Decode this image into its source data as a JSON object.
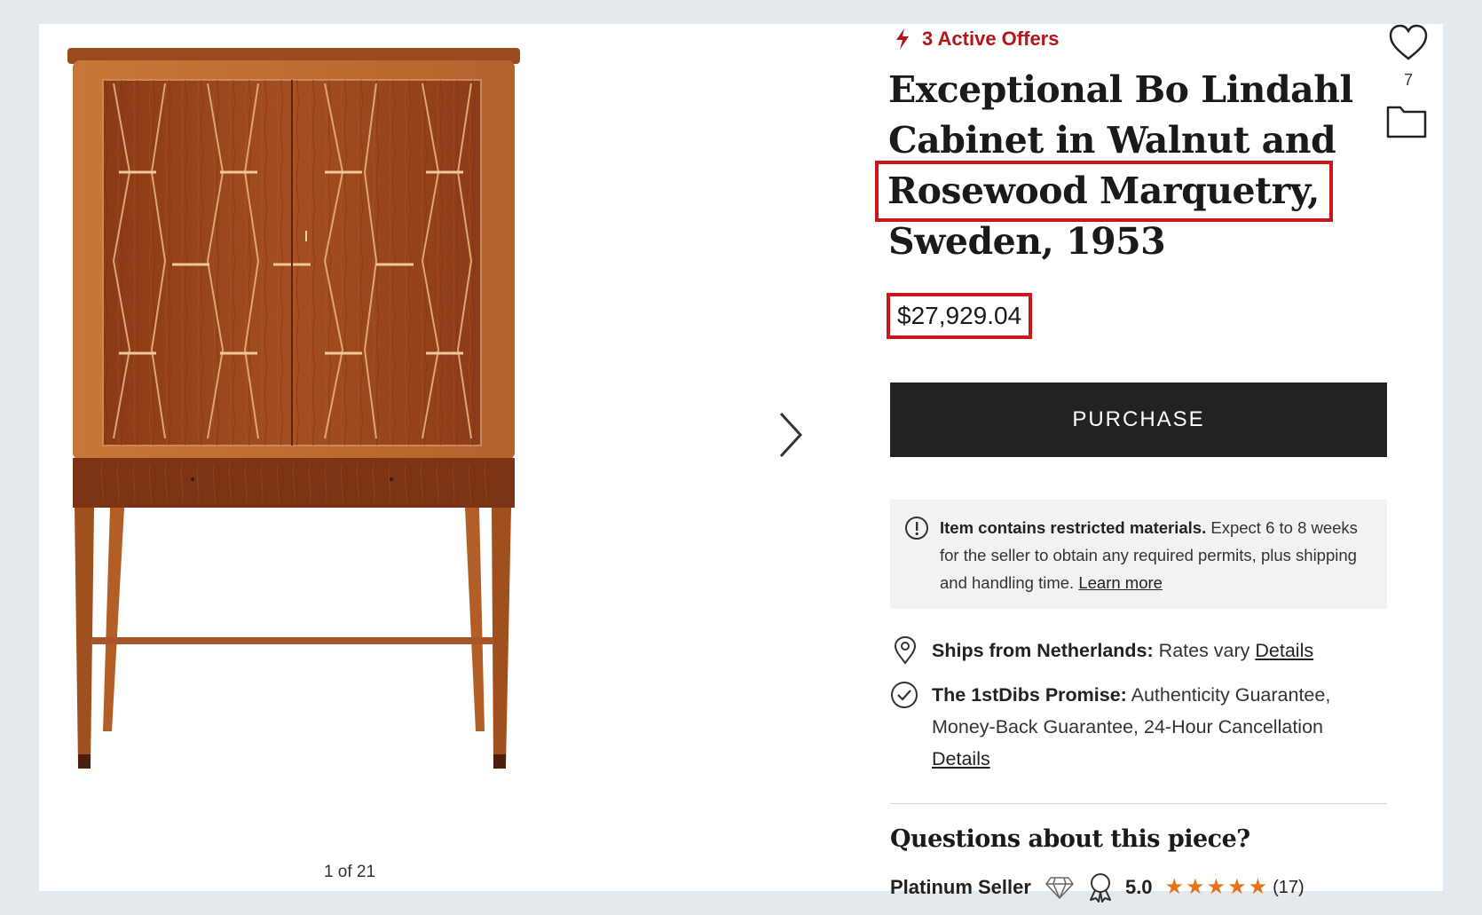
{
  "colors": {
    "accent_red": "#b3151b",
    "highlight_red": "#c8161d",
    "button_bg": "#222222",
    "star_orange": "#e77318",
    "wood": "#a14a1f"
  },
  "gallery": {
    "counter": "1 of 21",
    "next_icon": "chevron-right-icon"
  },
  "offers": {
    "icon": "lightning-icon",
    "label": "3 Active Offers"
  },
  "favorites": {
    "icon": "heart-icon",
    "count": "7",
    "folder_icon": "folder-icon"
  },
  "product": {
    "title_lines": [
      "Exceptional Bo Lindahl",
      "Cabinet in Walnut and",
      "Rosewood Marquetry,",
      "Sweden, 1953"
    ],
    "price": "$27,929.04"
  },
  "purchase_label": "PURCHASE",
  "notice": {
    "icon": "alert-circle-icon",
    "bold": "Item contains restricted materials.",
    "text": " Expect 6 to 8 weeks for the seller to obtain any required permits, plus shipping and handling time. ",
    "link": "Learn more"
  },
  "shipping": {
    "icon": "location-pin-icon",
    "bold": "Ships from Netherlands:",
    "text": " Rates vary ",
    "link": "Details"
  },
  "promise": {
    "icon": "check-circle-icon",
    "bold": "The 1stDibs Promise:",
    "text": " Authenticity Guarantee, Money-Back Guarantee, 24-Hour Cancellation",
    "link": "Details"
  },
  "questions": "Questions about this piece?",
  "seller": {
    "label": "Platinum Seller",
    "gem_icon": "diamond-icon",
    "award_icon": "award-ribbon-icon",
    "score": "5.0",
    "stars": 5,
    "reviews": "(17)"
  }
}
